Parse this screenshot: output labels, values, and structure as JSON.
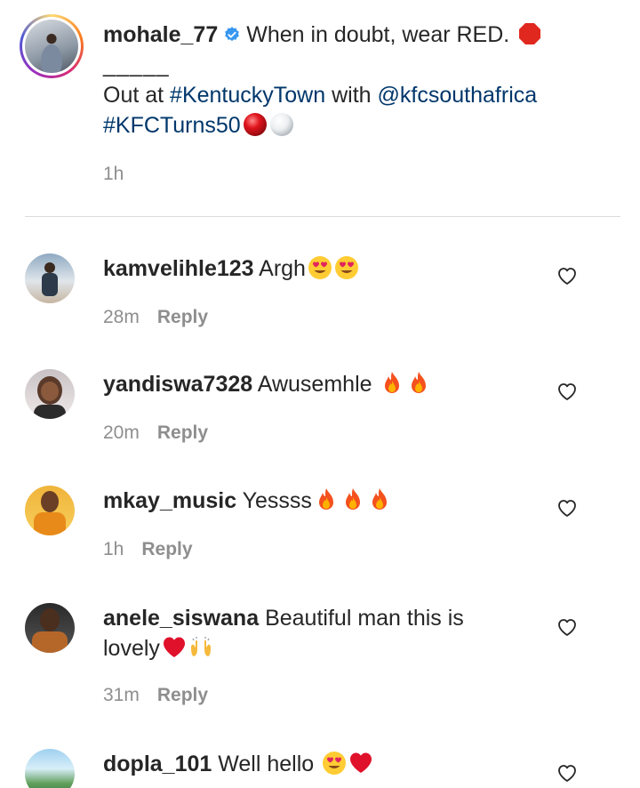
{
  "caption": {
    "username": "mohale_77",
    "line1": "When in doubt, wear RED.",
    "separator": "_____",
    "line2_prefix": "Out at",
    "hashtag1": "#KentuckyTown",
    "with_text": "with",
    "mention": "@kfcsouthafrica",
    "hashtag2": "#KFCTurns50",
    "time": "1h"
  },
  "comments": [
    {
      "username": "kamvelihle123",
      "text": "Argh",
      "time": "28m",
      "reply_label": "Reply",
      "emojis": [
        "heart-eyes-emoji",
        "heart-eyes-emoji"
      ]
    },
    {
      "username": "yandiswa7328",
      "text": "Awusemhle",
      "time": "20m",
      "reply_label": "Reply",
      "emojis": [
        "fire-emoji",
        "fire-emoji"
      ]
    },
    {
      "username": "mkay_music",
      "text": "Yessss",
      "time": "1h",
      "reply_label": "Reply",
      "emojis": [
        "fire-emoji",
        "fire-emoji",
        "fire-emoji"
      ]
    },
    {
      "username": "anele_siswana",
      "text_line1": "Beautiful man this is",
      "text_line2": "lovely",
      "time": "31m",
      "reply_label": "Reply",
      "emojis": [
        "red-heart-emoji",
        "raising-hands-emoji"
      ]
    },
    {
      "username": "dopla_101",
      "text": "Well hello",
      "emojis": [
        "heart-eyes-emoji",
        "red-heart-emoji"
      ]
    }
  ],
  "icons": {
    "verified": "verified-badge-icon",
    "stop_sign": "stop-sign-emoji",
    "red_ball": "red-circle-emoji",
    "white_ball": "white-circle-emoji",
    "like": "heart-outline-icon"
  },
  "colors": {
    "text": "#262626",
    "secondary": "#8e8e8e",
    "link": "#00376b",
    "verified": "#3897f0",
    "divider": "#dbdbdb"
  }
}
